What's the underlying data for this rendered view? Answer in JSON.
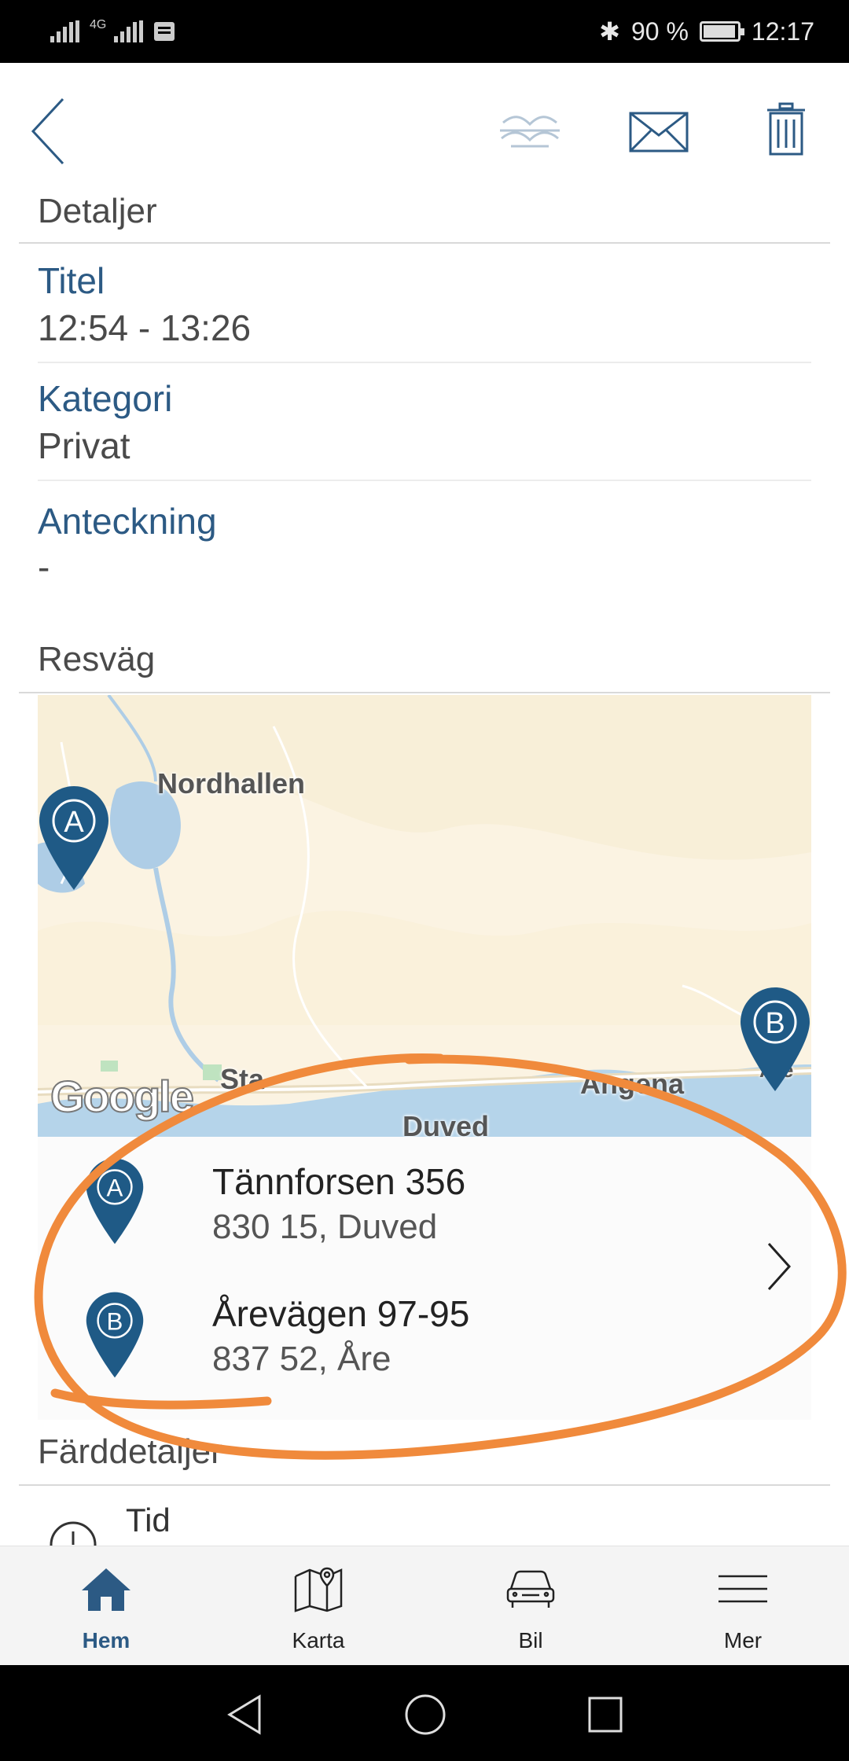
{
  "status_bar": {
    "network": "4G",
    "battery": "90 %",
    "battery_level": 0.9,
    "time": "12:17"
  },
  "toolbar": {
    "back_icon": "chevron-left-icon",
    "boat_icon": "boat-icon",
    "mail_icon": "envelope-icon",
    "delete_icon": "trash-icon"
  },
  "details": {
    "heading": "Detaljer",
    "title_label": "Titel",
    "title_value": "12:54 - 13:26",
    "category_label": "Kategori",
    "category_value": "Privat",
    "note_label": "Anteckning",
    "note_value": "-"
  },
  "route": {
    "heading": "Resväg",
    "map_labels": {
      "nordhallen": "Nordhallen",
      "sta": "Sta",
      "duved": "Duved",
      "angena": "Angena",
      "are": "Åre"
    },
    "google_logo": "Google",
    "pin_a": "A",
    "pin_b": "B",
    "start": {
      "street": "Tännforsen 356",
      "postal": "830 15, Duved"
    },
    "end": {
      "street": "Årevägen 97-95",
      "postal": "837 52, Åre"
    }
  },
  "trip_details": {
    "heading": "Färddetaljer",
    "time_label": "Tid"
  },
  "bottom_nav": {
    "items": [
      {
        "label": "Hem",
        "icon": "home-icon",
        "active": true
      },
      {
        "label": "Karta",
        "icon": "map-icon",
        "active": false
      },
      {
        "label": "Bil",
        "icon": "car-icon",
        "active": false
      },
      {
        "label": "Mer",
        "icon": "menu-icon",
        "active": false
      }
    ]
  },
  "colors": {
    "accent": "#2c5a84",
    "annotation": "#f08a3c"
  }
}
